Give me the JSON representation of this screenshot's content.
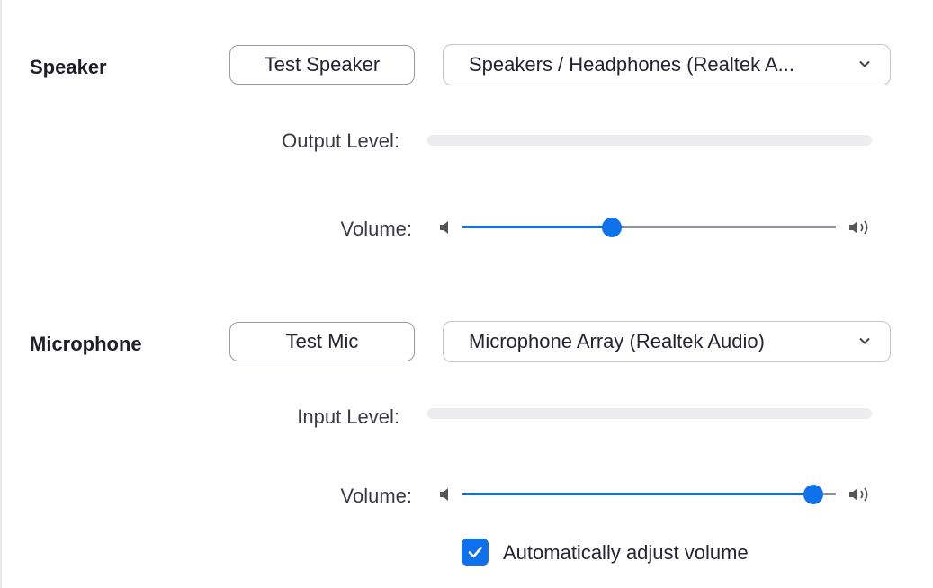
{
  "speaker": {
    "label": "Speaker",
    "test_button": "Test Speaker",
    "device_selected": "Speakers / Headphones (Realtek A...",
    "output_level_label": "Output Level:",
    "output_level": 0,
    "volume_label": "Volume:",
    "volume": 0.4
  },
  "microphone": {
    "label": "Microphone",
    "test_button": "Test Mic",
    "device_selected": "Microphone Array (Realtek Audio)",
    "input_level_label": "Input Level:",
    "input_level": 0,
    "volume_label": "Volume:",
    "volume": 0.94,
    "auto_adjust_label": "Automatically adjust volume",
    "auto_adjust_checked": true
  },
  "colors": {
    "accent": "#0e72ed",
    "track": "#8f8f9a",
    "level_bg": "#ececee"
  },
  "icons": [
    "chevron-down-icon",
    "speaker-low-icon",
    "speaker-high-icon",
    "checkmark-icon"
  ]
}
